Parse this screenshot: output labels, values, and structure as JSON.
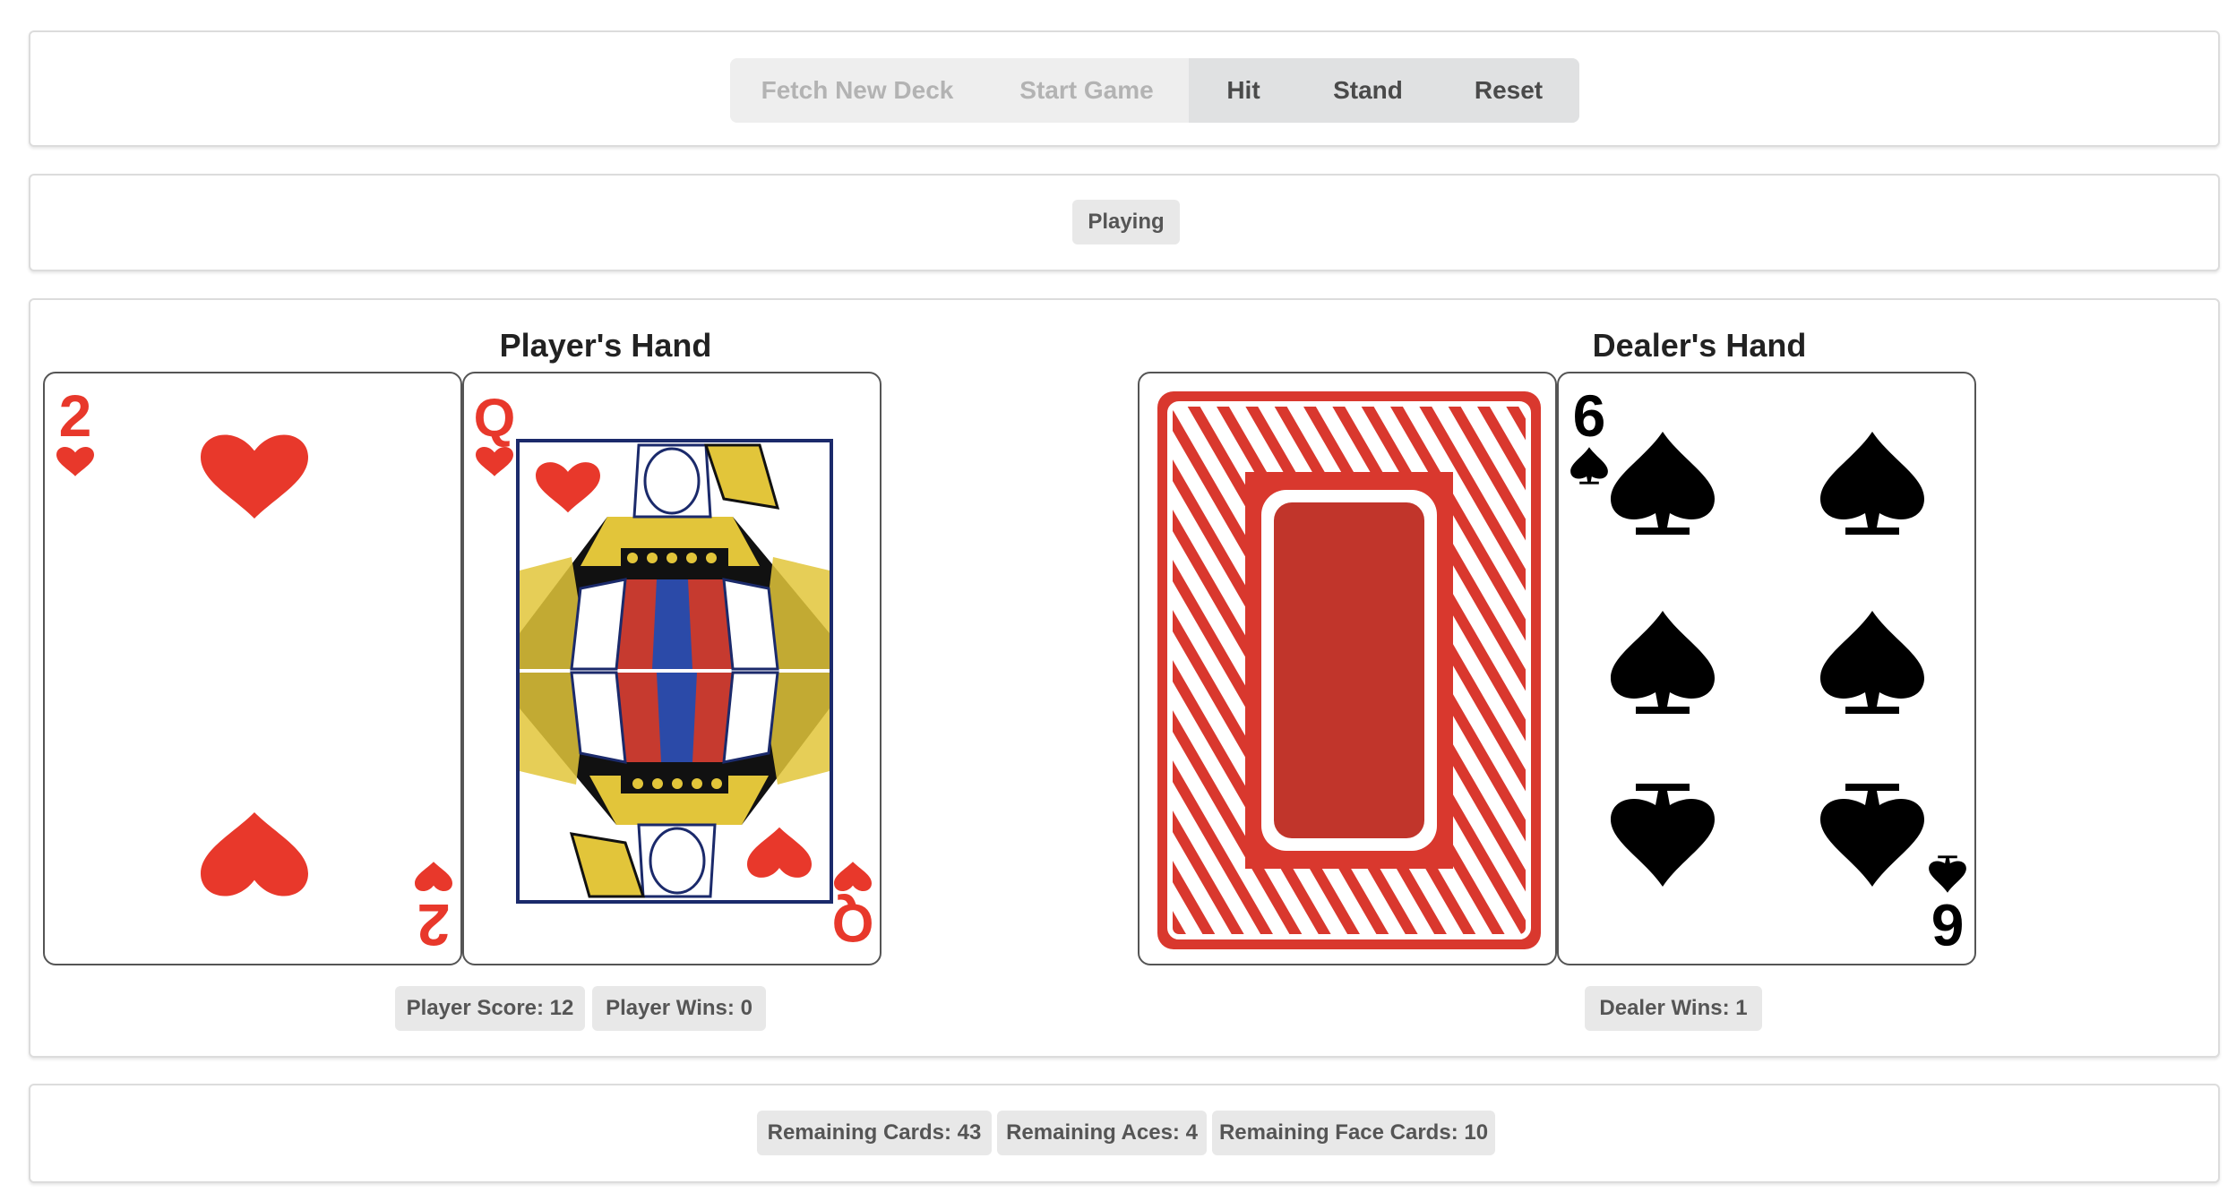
{
  "controls": {
    "fetch_label": "Fetch New Deck",
    "start_label": "Start Game",
    "hit_label": "Hit",
    "stand_label": "Stand",
    "reset_label": "Reset"
  },
  "status": "Playing",
  "player": {
    "title": "Player's Hand",
    "cards": [
      {
        "rank": "2",
        "suit": "hearts"
      },
      {
        "rank": "Q",
        "suit": "hearts"
      }
    ],
    "score_label": "Player Score: 12",
    "wins_label": "Player Wins: 0"
  },
  "dealer": {
    "title": "Dealer's Hand",
    "cards": [
      {
        "rank": "",
        "suit": "face-down"
      },
      {
        "rank": "6",
        "suit": "spades"
      }
    ],
    "wins_label": "Dealer Wins: 1"
  },
  "deck": {
    "remaining_cards_label": "Remaining Cards: 43",
    "remaining_aces_label": "Remaining Aces: 4",
    "remaining_face_label": "Remaining Face Cards: 10"
  },
  "colors": {
    "red_suit": "#e8382b",
    "black_suit": "#000000",
    "card_back": "#d9382e"
  }
}
